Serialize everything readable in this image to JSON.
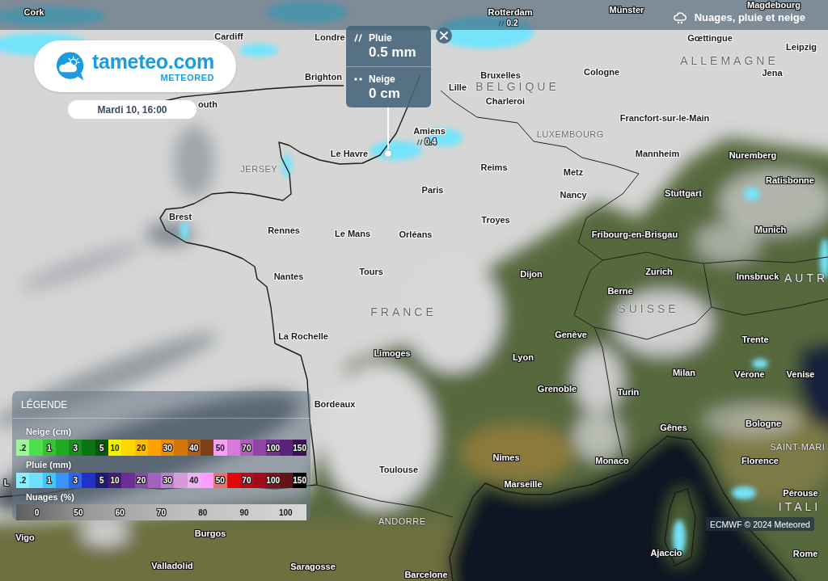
{
  "top_bar": {
    "layer_title": "Nuages, pluie et neige"
  },
  "brand": {
    "name": "tameteo.com",
    "tagline": "METEORED"
  },
  "date": "Mardi 10, 16:00",
  "map": {
    "labels": [
      {
        "kind": "city",
        "text": "Cork"
      },
      {
        "kind": "city",
        "text": "Rotterdam"
      },
      {
        "kind": "city",
        "text": "Münster"
      },
      {
        "kind": "city",
        "text": "Magdebourg"
      },
      {
        "kind": "rain",
        "text": "0.2"
      },
      {
        "kind": "city",
        "text": "Cardiff"
      },
      {
        "kind": "city",
        "text": "Londre"
      },
      {
        "kind": "city",
        "text": "Gœttingue"
      },
      {
        "kind": "city",
        "text": "Leipzig"
      },
      {
        "kind": "country",
        "text": "ALLEMAGNE"
      },
      {
        "kind": "city",
        "text": "Brighton"
      },
      {
        "kind": "city",
        "text": "Bruxelles"
      },
      {
        "kind": "city",
        "text": "Cologne"
      },
      {
        "kind": "city",
        "text": "Jena"
      },
      {
        "kind": "city",
        "text": "Lille"
      },
      {
        "kind": "country",
        "text": "BELGIQUE"
      },
      {
        "kind": "city",
        "text": "outh"
      },
      {
        "kind": "city",
        "text": "Charleroi"
      },
      {
        "kind": "city",
        "text": "Francfort-sur-le-Main"
      },
      {
        "kind": "city",
        "text": "Amiens"
      },
      {
        "kind": "territory",
        "text": "LUXEMBOURG"
      },
      {
        "kind": "rain",
        "text": "0.4"
      },
      {
        "kind": "city",
        "text": "Le Havre"
      },
      {
        "kind": "city",
        "text": "Mannheim"
      },
      {
        "kind": "city",
        "text": "Nuremberg"
      },
      {
        "kind": "territory",
        "text": "JERSEY"
      },
      {
        "kind": "city",
        "text": "Reims"
      },
      {
        "kind": "city",
        "text": "Metz"
      },
      {
        "kind": "city",
        "text": "Ratisbonne"
      },
      {
        "kind": "city",
        "text": "Paris"
      },
      {
        "kind": "city",
        "text": "Nancy"
      },
      {
        "kind": "city",
        "text": "Stuttgart"
      },
      {
        "kind": "city",
        "text": "Brest"
      },
      {
        "kind": "city",
        "text": "Troyes"
      },
      {
        "kind": "city",
        "text": "Rennes"
      },
      {
        "kind": "city",
        "text": "Le Mans"
      },
      {
        "kind": "city",
        "text": "Orléans"
      },
      {
        "kind": "city",
        "text": "Fribourg-en-Brisgau"
      },
      {
        "kind": "city",
        "text": "Munich"
      },
      {
        "kind": "city",
        "text": "Nantes"
      },
      {
        "kind": "city",
        "text": "Tours"
      },
      {
        "kind": "city",
        "text": "Dijon"
      },
      {
        "kind": "city",
        "text": "Zurich"
      },
      {
        "kind": "city",
        "text": "Innsbruck"
      },
      {
        "kind": "country",
        "text": "AUTR"
      },
      {
        "kind": "city",
        "text": "Berne"
      },
      {
        "kind": "country",
        "text": "FRANCE"
      },
      {
        "kind": "country",
        "text": "SUISSE"
      },
      {
        "kind": "city",
        "text": "La Rochelle"
      },
      {
        "kind": "city",
        "text": "Genève"
      },
      {
        "kind": "city",
        "text": "Trente"
      },
      {
        "kind": "city",
        "text": "Limoges"
      },
      {
        "kind": "city",
        "text": "Lyon"
      },
      {
        "kind": "city",
        "text": "Milan"
      },
      {
        "kind": "city",
        "text": "Vérone"
      },
      {
        "kind": "city",
        "text": "Venise"
      },
      {
        "kind": "city",
        "text": "Grenoble"
      },
      {
        "kind": "city",
        "text": "Turin"
      },
      {
        "kind": "city",
        "text": "Bordeaux"
      },
      {
        "kind": "city",
        "text": "Gênes"
      },
      {
        "kind": "city",
        "text": "Bologne"
      },
      {
        "kind": "territory",
        "text": "SAINT-MARI"
      },
      {
        "kind": "city",
        "text": "Nimes"
      },
      {
        "kind": "city",
        "text": "Monaco"
      },
      {
        "kind": "city",
        "text": "Florence"
      },
      {
        "kind": "city",
        "text": "Toulouse"
      },
      {
        "kind": "city",
        "text": "L"
      },
      {
        "kind": "city",
        "text": "Marseille"
      },
      {
        "kind": "city",
        "text": "Pérouse"
      },
      {
        "kind": "country",
        "text": "ITALI"
      },
      {
        "kind": "territory",
        "text": "ANDORRE"
      },
      {
        "kind": "city",
        "text": "Vigo"
      },
      {
        "kind": "city",
        "text": "Burgos"
      },
      {
        "kind": "city",
        "text": "Ajaccio"
      },
      {
        "kind": "city",
        "text": "Rome"
      },
      {
        "kind": "city",
        "text": "Valladolid"
      },
      {
        "kind": "city",
        "text": "Saragosse"
      },
      {
        "kind": "city",
        "text": "Barcelone"
      }
    ]
  },
  "popup": {
    "rows": [
      {
        "kind": "rain",
        "label": "Pluie",
        "value": "0.5 mm"
      },
      {
        "kind": "snow",
        "label": "Neige",
        "value": "0 cm"
      }
    ]
  },
  "legend": {
    "title": "LÉGENDE",
    "scales": [
      {
        "kind": "swatches",
        "label": "Neige (cm)",
        "cells": [
          {
            "label": ".2",
            "color": "#9ef59a"
          },
          {
            "color": "#4be04b"
          },
          {
            "label": "1",
            "color": "#33c433"
          },
          {
            "color": "#23a823"
          },
          {
            "label": "3",
            "color": "#178f1f"
          },
          {
            "color": "#0b7515"
          },
          {
            "label": "5",
            "color": "#06560c"
          },
          {
            "label": "10",
            "color": "#f2f200"
          },
          {
            "color": "#ffd700"
          },
          {
            "label": "20",
            "color": "#ffbf00"
          },
          {
            "color": "#ffa200"
          },
          {
            "label": "30",
            "color": "#f08a00"
          },
          {
            "color": "#d2760e"
          },
          {
            "label": "40",
            "color": "#b05e14"
          },
          {
            "color": "#7a4218"
          },
          {
            "label": "50",
            "color": "#f5a0f5"
          },
          {
            "color": "#d47ad8"
          },
          {
            "label": "70",
            "color": "#b45cc0"
          },
          {
            "color": "#9444a8"
          },
          {
            "label": "100",
            "color": "#74308f"
          },
          {
            "color": "#5a2278"
          },
          {
            "label": "150",
            "color": "#3c1058"
          }
        ]
      },
      {
        "kind": "swatches",
        "label": "Pluie (mm)",
        "cells": [
          {
            "label": ".2",
            "color": "#8af0ff"
          },
          {
            "color": "#6ee0ff"
          },
          {
            "label": "1",
            "color": "#3ec8ff"
          },
          {
            "color": "#3a92ff"
          },
          {
            "label": "3",
            "color": "#2c64f0"
          },
          {
            "color": "#2232c8"
          },
          {
            "label": "5",
            "color": "#1c1c78"
          },
          {
            "label": "10",
            "color": "#4a1a80"
          },
          {
            "color": "#6a2e94"
          },
          {
            "label": "20",
            "color": "#8a48aa"
          },
          {
            "color": "#a462bc"
          },
          {
            "label": "30",
            "color": "#be80cc"
          },
          {
            "color": "#d49ada"
          },
          {
            "label": "40",
            "color": "#eab4ee"
          },
          {
            "color": "#ff9cff"
          },
          {
            "label": "50",
            "color": "#f07070"
          },
          {
            "color": "#e00a0a"
          },
          {
            "label": "70",
            "color": "#c00814"
          },
          {
            "color": "#a00c1c"
          },
          {
            "label": "100",
            "color": "#84101c"
          },
          {
            "color": "#641418"
          },
          {
            "label": "150",
            "color": "#000000"
          }
        ]
      },
      {
        "kind": "gradient",
        "label": "Nuages (%)",
        "ticks": [
          "0",
          "50",
          "60",
          "70",
          "80",
          "90",
          "100"
        ]
      }
    ]
  },
  "attribution": "ECMWF © 2024 Meteored"
}
